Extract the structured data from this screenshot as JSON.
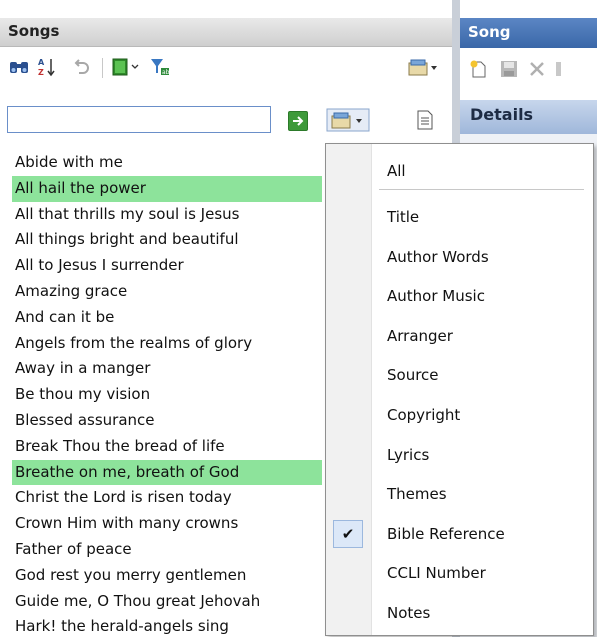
{
  "songs_panel": {
    "title": "Songs",
    "search": {
      "value": "",
      "placeholder": ""
    }
  },
  "song_panel": {
    "title": "Song",
    "details_title": "Details"
  },
  "songs": [
    {
      "label": "Abide with me",
      "highlighted": false
    },
    {
      "label": "All hail the power",
      "highlighted": true
    },
    {
      "label": "All that thrills my soul is Jesus",
      "highlighted": false
    },
    {
      "label": "All things bright and beautiful",
      "highlighted": false
    },
    {
      "label": "All to Jesus I surrender",
      "highlighted": false
    },
    {
      "label": "Amazing grace",
      "highlighted": false
    },
    {
      "label": "And can it be",
      "highlighted": false
    },
    {
      "label": "Angels from the realms of glory",
      "highlighted": false
    },
    {
      "label": "Away in a manger",
      "highlighted": false
    },
    {
      "label": "Be thou my vision",
      "highlighted": false
    },
    {
      "label": "Blessed assurance",
      "highlighted": false
    },
    {
      "label": "Break Thou the bread of life",
      "highlighted": false
    },
    {
      "label": "Breathe on me, breath of God",
      "highlighted": true
    },
    {
      "label": "Christ the Lord is risen today",
      "highlighted": false
    },
    {
      "label": "Crown Him with many crowns",
      "highlighted": false
    },
    {
      "label": "Father of peace",
      "highlighted": false
    },
    {
      "label": "God rest you merry gentlemen",
      "highlighted": false
    },
    {
      "label": "Guide me, O Thou great Jehovah",
      "highlighted": false
    },
    {
      "label": "Hark! the herald-angels sing",
      "highlighted": false
    }
  ],
  "filter_menu": {
    "all_label": "All",
    "items": [
      {
        "label": "Title",
        "checked": false
      },
      {
        "label": "Author Words",
        "checked": false
      },
      {
        "label": "Author Music",
        "checked": false
      },
      {
        "label": "Arranger",
        "checked": false
      },
      {
        "label": "Source",
        "checked": false
      },
      {
        "label": "Copyright",
        "checked": false
      },
      {
        "label": "Lyrics",
        "checked": false
      },
      {
        "label": "Themes",
        "checked": false
      },
      {
        "label": "Bible Reference",
        "checked": true
      },
      {
        "label": "CCLI Number",
        "checked": false
      },
      {
        "label": "Notes",
        "checked": false
      }
    ],
    "check_glyph": "✔"
  },
  "colors": {
    "highlight": "#8de39b",
    "song_header": "#3a67a8",
    "checked_bg": "#dce8f8"
  },
  "icons": {
    "find": "binoculars-icon",
    "sort": "sort-az-icon",
    "undo": "undo-icon",
    "book": "book-icon",
    "clear_filter": "clear-filter-icon",
    "options": "options-icon",
    "go": "go-arrow-icon",
    "filter": "filter-fields-icon",
    "document": "document-icon"
  }
}
